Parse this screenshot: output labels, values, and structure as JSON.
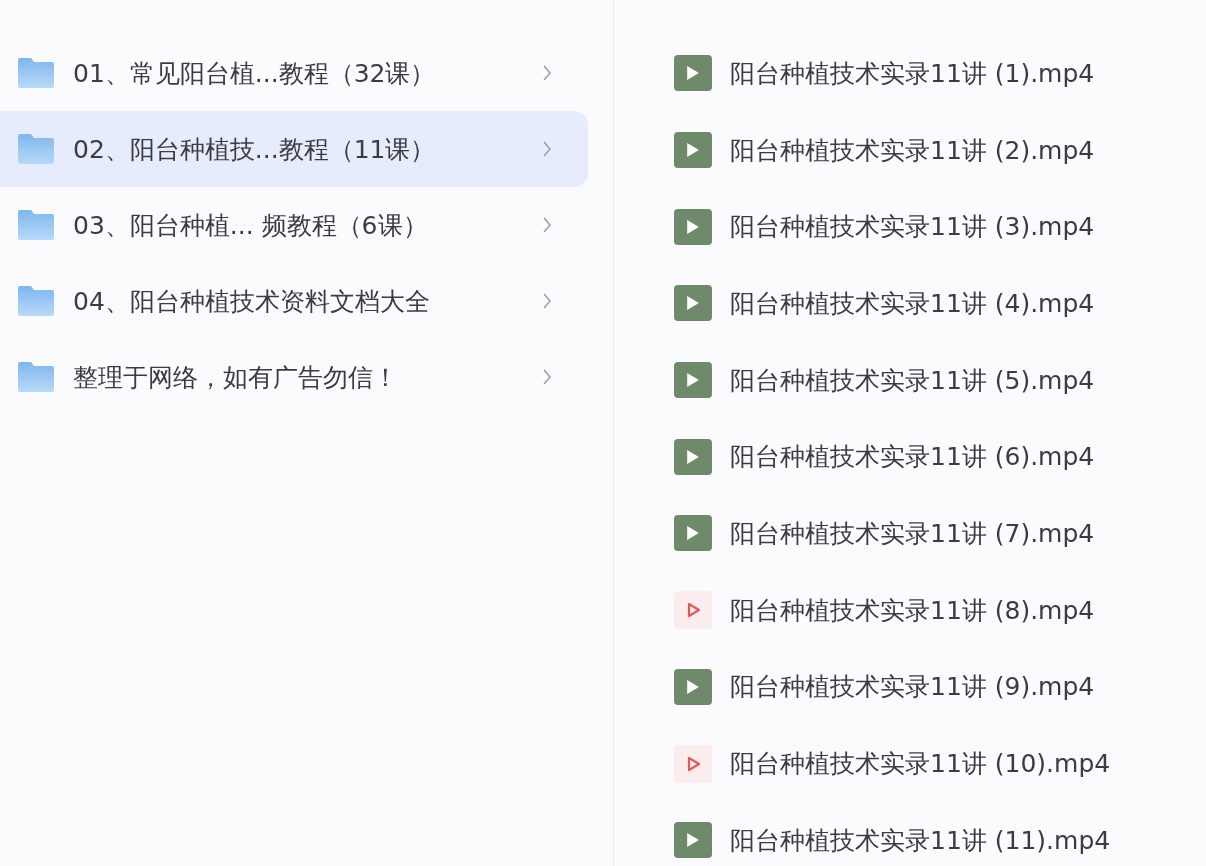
{
  "folders": [
    {
      "name": "01、常见阳台植...教程（32课）",
      "selected": false
    },
    {
      "name": "02、阳台种植技...教程（11课）",
      "selected": true
    },
    {
      "name": "03、阳台种植... 频教程（6课）",
      "selected": false
    },
    {
      "name": "04、阳台种植技术资料文档大全",
      "selected": false
    },
    {
      "name": "整理于网络，如有广告勿信！",
      "selected": false
    }
  ],
  "files": [
    {
      "name": "阳台种植技术实录11讲 (1).mp4",
      "kind": "thumbnail"
    },
    {
      "name": "阳台种植技术实录11讲 (2).mp4",
      "kind": "thumbnail"
    },
    {
      "name": "阳台种植技术实录11讲 (3).mp4",
      "kind": "thumbnail"
    },
    {
      "name": "阳台种植技术实录11讲 (4).mp4",
      "kind": "thumbnail"
    },
    {
      "name": "阳台种植技术实录11讲 (5).mp4",
      "kind": "thumbnail"
    },
    {
      "name": "阳台种植技术实录11讲 (6).mp4",
      "kind": "thumbnail"
    },
    {
      "name": "阳台种植技术实录11讲 (7).mp4",
      "kind": "thumbnail"
    },
    {
      "name": "阳台种植技术实录11讲 (8).mp4",
      "kind": "plain"
    },
    {
      "name": "阳台种植技术实录11讲 (9).mp4",
      "kind": "thumbnail"
    },
    {
      "name": "阳台种植技术实录11讲 (10).mp4",
      "kind": "plain"
    },
    {
      "name": "阳台种植技术实录11讲 (11).mp4",
      "kind": "thumbnail"
    }
  ]
}
